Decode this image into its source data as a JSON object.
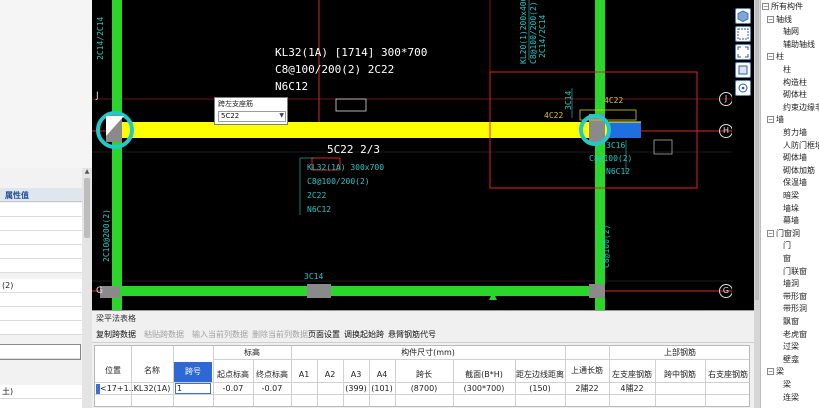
{
  "left_panel": {
    "header": "属性值",
    "rows": [
      "",
      "",
      "",
      "",
      "",
      "(2)",
      "",
      "",
      "",
      "",
      "土)",
      ""
    ]
  },
  "canvas": {
    "beam_label": {
      "line1": "KL32(1A) [1714] 300*700",
      "line2": "C8@100/200(2) 2C22",
      "line3": "N6C12"
    },
    "span_label": "5C22 2/3",
    "dialog": {
      "title": "跨左支座筋",
      "value": "5C22"
    },
    "orig_text": {
      "l1": "KL32(1A) 300x700",
      "l2": "C8@100/200(2)",
      "l3": "2C22",
      "l4": "N6C12"
    },
    "right_texts": {
      "r1": "4C22",
      "r2": "4C22",
      "r3": "3C16",
      "r4": "C8@100(2)",
      "r5": "N6C12",
      "bottom": "3C14"
    },
    "vertical_texts": {
      "v1": "2C14/2C14",
      "v2": "2C10@200(2)",
      "v3": "KL20(1)200x400",
      "v4": "C8@100/200(2)",
      "v5": "3C14",
      "v6": "2C14/2C14",
      "v7": "C8@100(2)"
    },
    "axes": {
      "j": "J",
      "h": "H",
      "g": "G"
    }
  },
  "component_tree": {
    "items": [
      {
        "label": "所有构件",
        "expander": "−",
        "level": 0
      },
      {
        "label": "轴线",
        "expander": "−",
        "level": 1
      },
      {
        "label": "轴网",
        "level": 2
      },
      {
        "label": "辅助轴线",
        "level": 2
      },
      {
        "label": "柱",
        "expander": "−",
        "level": 1
      },
      {
        "label": "柱",
        "level": 2
      },
      {
        "label": "构造柱",
        "level": 2
      },
      {
        "label": "砌体柱",
        "level": 2
      },
      {
        "label": "约束边缘非",
        "level": 2
      },
      {
        "label": "墙",
        "expander": "−",
        "level": 1
      },
      {
        "label": "剪力墙",
        "level": 2
      },
      {
        "label": "人防门框墙",
        "level": 2
      },
      {
        "label": "砌体墙",
        "level": 2
      },
      {
        "label": "砌体加筋",
        "level": 2
      },
      {
        "label": "保温墙",
        "level": 2
      },
      {
        "label": "暗梁",
        "level": 2
      },
      {
        "label": "墙垛",
        "level": 2
      },
      {
        "label": "幕墙",
        "level": 2
      },
      {
        "label": "门窗洞",
        "expander": "−",
        "level": 1
      },
      {
        "label": "门",
        "level": 2
      },
      {
        "label": "窗",
        "level": 2
      },
      {
        "label": "门联窗",
        "level": 2
      },
      {
        "label": "墙洞",
        "level": 2
      },
      {
        "label": "带形窗",
        "level": 2
      },
      {
        "label": "带形洞",
        "level": 2
      },
      {
        "label": "飘窗",
        "level": 2
      },
      {
        "label": "老虎窗",
        "level": 2
      },
      {
        "label": "过梁",
        "level": 2
      },
      {
        "label": "壁龛",
        "level": 2
      },
      {
        "label": "梁",
        "expander": "−",
        "level": 1
      },
      {
        "label": "梁",
        "level": 2
      },
      {
        "label": "连梁",
        "level": 2
      }
    ]
  },
  "beam_table": {
    "title": "梁平法表格",
    "toolbar": [
      {
        "label": "复制跨数据",
        "enabled": true
      },
      {
        "label": "粘贴跨数据",
        "enabled": false
      },
      {
        "label": "输入当前列数据",
        "enabled": false
      },
      {
        "label": "删除当前列数据",
        "enabled": false
      },
      {
        "label": "页面设置",
        "enabled": true
      },
      {
        "label": "调换起始跨",
        "enabled": true
      },
      {
        "label": "悬臂钢筋代号",
        "enabled": true
      }
    ],
    "headers": {
      "position": "位置",
      "name": "名称",
      "span_no": "跨号",
      "elevation": "标高",
      "start_elev": "起点标高",
      "end_elev": "终点标高",
      "dims": "构件尺寸(mm)",
      "a1": "A1",
      "a2": "A2",
      "a3": "A3",
      "a4": "A4",
      "span_len": "跨长",
      "section": "截面(B*H)",
      "dist_edge": "距左边线距离",
      "top_through": "上通长筋",
      "top_rebar": "上部钢筋",
      "left_support": "左支座钢筋",
      "mid_span": "跨中钢筋",
      "right_support": "右支座钢筋"
    },
    "row": {
      "position": "<17+1...",
      "name": "KL32(1A)",
      "span_no": "1",
      "start_elev": "-0.07",
      "end_elev": "-0.07",
      "a1": "",
      "a2": "",
      "a3": "(399)",
      "a4": "(101)",
      "span_len": "(8700)",
      "section": "(300*700)",
      "dist_edge": "(150)",
      "top_through": "2陠22",
      "left_support": "4陠22",
      "mid_span": "",
      "right_support": ""
    }
  },
  "colors": {
    "beam_yellow": "#ffff00",
    "column_green": "#2bd62b",
    "highlight_cyan": "#22c9c9",
    "selection_red": "#e0202a",
    "blue_fill": "#1e6fe0"
  }
}
